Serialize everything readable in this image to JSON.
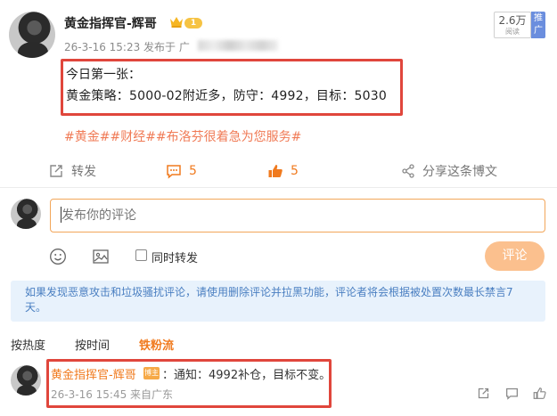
{
  "post": {
    "author": "黄金指挥官-辉哥",
    "level_badge": "1",
    "meta": "26-3-16 15:23 发布于 广",
    "reads_count": "2.6万",
    "reads_label": "阅读",
    "promote_label": "推广",
    "body_line1": "今日第一张：",
    "body_line2": "黄金策略：5000-02附近多，防守：4992，目标：5030",
    "hashtags": "#黄金##财经##布洛芬很着急为您服务#"
  },
  "actions": {
    "repost_label": "转发",
    "comment_count": "5",
    "like_count": "5",
    "share_label": "分享这条博文"
  },
  "composer": {
    "placeholder": "发布你的评论",
    "also_repost_label": "同时转发",
    "submit_label": "评论"
  },
  "notice": "如果发现恶意攻击和垃圾骚扰评论，请使用删除评论并拉黑功能，评论者将会根据被处置次数最长禁言7天。",
  "sort_tabs": [
    "按热度",
    "按时间",
    "铁粉流"
  ],
  "comments": [
    {
      "user": "黄金指挥官-辉哥",
      "badge": "博主",
      "text": "：通知：4992补仓，目标不变。",
      "time": "26-3-16 15:45 来自广东"
    }
  ],
  "colors": {
    "accent": "#f07a1e",
    "highlight_border": "#e0463c",
    "notice_bg": "#e8f2fc",
    "submit_bg": "#fbc08e"
  }
}
